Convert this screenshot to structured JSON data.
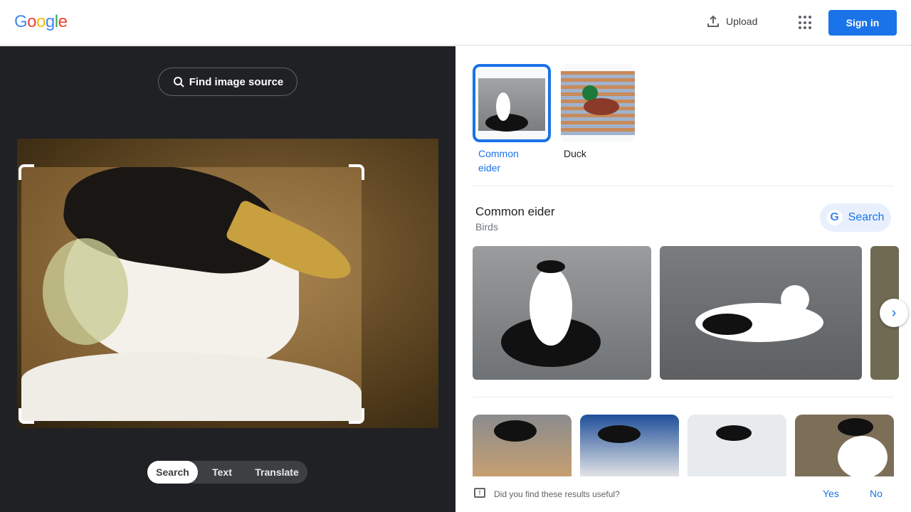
{
  "header": {
    "logo": [
      "G",
      "o",
      "o",
      "g",
      "l",
      "e"
    ],
    "logo_colors": [
      "#4285f4",
      "#ea4335",
      "#fbbc05",
      "#4285f4",
      "#34a853",
      "#ea4335"
    ],
    "upload_label": "Upload",
    "signin_label": "Sign in"
  },
  "left": {
    "find_source_label": "Find image source",
    "modes": [
      "Search",
      "Text",
      "Translate"
    ],
    "active_mode": "Search"
  },
  "right": {
    "chips": [
      {
        "label": "Common eider",
        "selected": true
      },
      {
        "label": "Duck",
        "selected": false
      }
    ],
    "entity": {
      "title": "Common eider",
      "subtitle": "Birds",
      "search_label": "Search"
    },
    "feedback": {
      "question": "Did you find these results useful?",
      "yes": "Yes",
      "no": "No"
    }
  },
  "colors": {
    "accent": "#1a73e8",
    "dark_panel": "#202124"
  }
}
